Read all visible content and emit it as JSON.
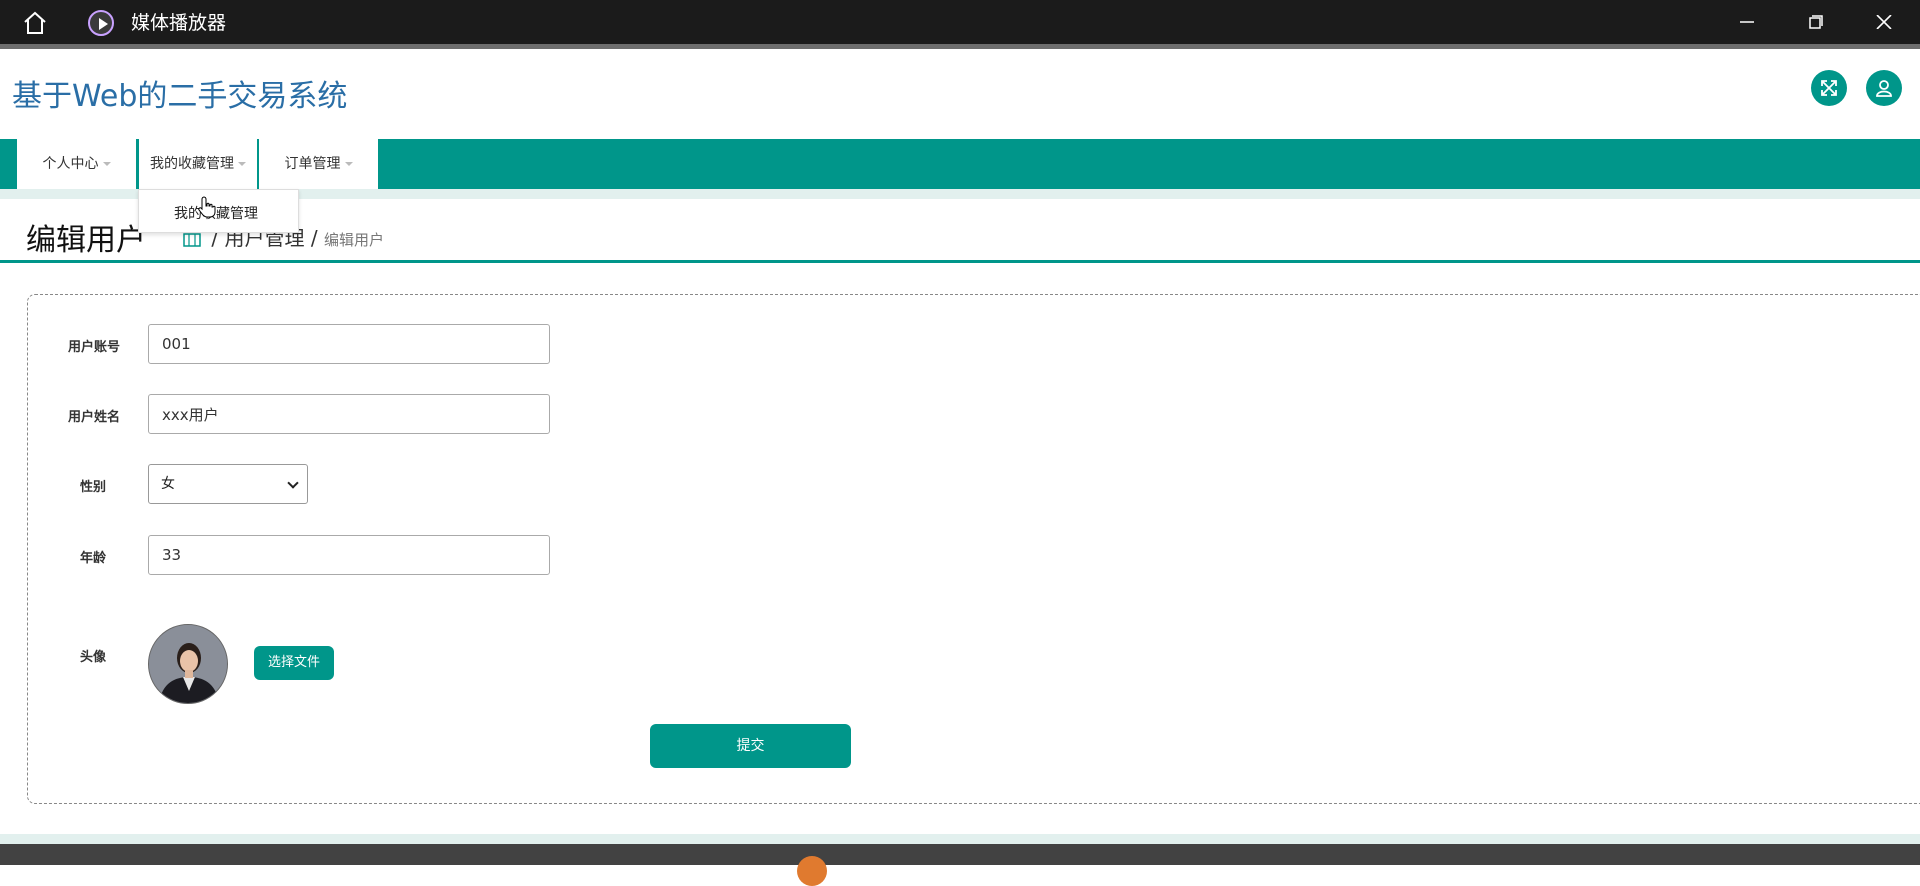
{
  "window": {
    "app_title": "媒体播放器",
    "home_icon": "home-icon",
    "controls": [
      "minimize-icon",
      "restore-icon",
      "close-icon"
    ]
  },
  "header": {
    "brand": "基于Web的二手交易系统",
    "icons": [
      "expand-icon",
      "user-icon"
    ]
  },
  "nav": {
    "items": [
      {
        "label": "个人中心"
      },
      {
        "label": "我的收藏管理"
      },
      {
        "label": "订单管理"
      }
    ],
    "dropdown": {
      "item": "我的收藏管理"
    }
  },
  "page": {
    "title": "编辑用户",
    "breadcrumb": {
      "separator": "/",
      "parent": "用户管理",
      "current": "编辑用户"
    }
  },
  "form": {
    "account": {
      "label": "用户账号",
      "value": "001"
    },
    "name": {
      "label": "用户姓名",
      "value": "xxx用户"
    },
    "gender": {
      "label": "性别",
      "value": "女"
    },
    "age": {
      "label": "年龄",
      "value": "33"
    },
    "avatar": {
      "label": "头像",
      "button": "选择文件"
    },
    "submit": "提交"
  },
  "colors": {
    "accent": "#00968a",
    "brand_text": "#2a6ea6",
    "titlebar": "#1b1b1b"
  }
}
